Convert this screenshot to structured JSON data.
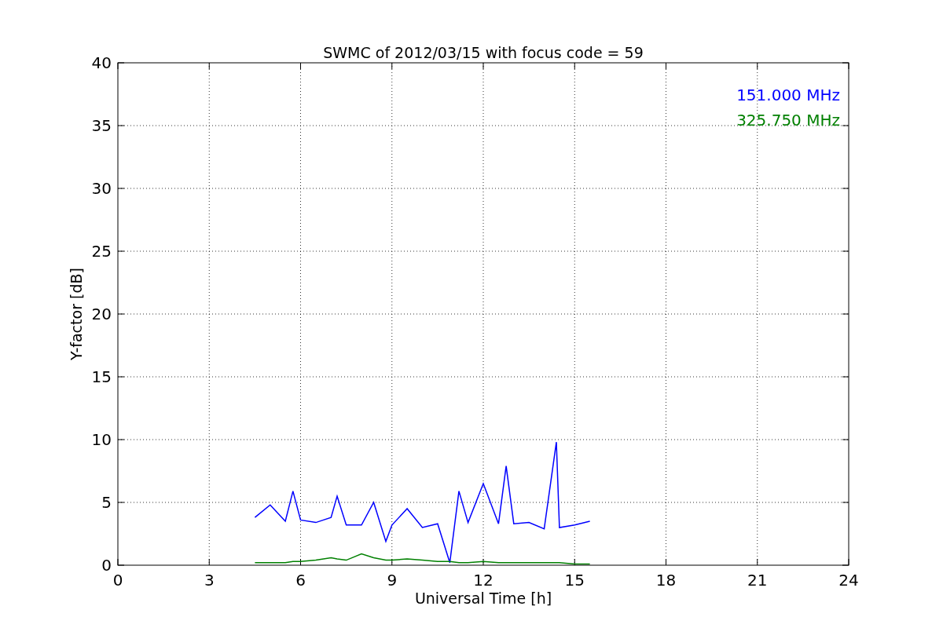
{
  "chart_data": {
    "type": "line",
    "title": "SWMC of 2012/03/15 with focus code = 59",
    "xlabel": "Universal Time [h]",
    "ylabel": "Y-factor [dB]",
    "x": [
      4.5,
      5,
      5.5,
      5.75,
      6,
      6.5,
      7,
      7.2,
      7.5,
      8,
      8.4,
      8.8,
      9,
      9.5,
      10,
      10.5,
      10.9,
      11.2,
      11.5,
      12,
      12.5,
      12.75,
      13,
      13.5,
      14,
      14.4,
      14.5,
      15,
      15.5
    ],
    "series": [
      {
        "name": "151.000 MHz",
        "color": "#0000ff",
        "values": [
          3.8,
          4.8,
          3.5,
          5.9,
          3.6,
          3.4,
          3.8,
          5.5,
          3.2,
          3.2,
          5.0,
          1.9,
          3.2,
          4.5,
          3.0,
          3.3,
          0.2,
          5.9,
          3.4,
          6.5,
          3.3,
          7.9,
          3.3,
          3.4,
          2.9,
          9.8,
          3.0,
          3.2,
          3.5
        ]
      },
      {
        "name": "325.750 MHz",
        "color": "#008000",
        "values": [
          0.2,
          0.2,
          0.2,
          0.3,
          0.3,
          0.4,
          0.6,
          0.5,
          0.4,
          0.9,
          0.6,
          0.4,
          0.4,
          0.5,
          0.4,
          0.3,
          0.3,
          0.2,
          0.2,
          0.3,
          0.2,
          0.2,
          0.2,
          0.2,
          0.2,
          0.2,
          0.2,
          0.1,
          0.1
        ]
      }
    ],
    "grid": true,
    "xlim": [
      0,
      24
    ],
    "ylim": [
      0,
      40
    ],
    "xticks": [
      0,
      3,
      6,
      9,
      12,
      15,
      18,
      21,
      24
    ],
    "yticks": [
      0,
      5,
      10,
      15,
      20,
      25,
      30,
      35,
      40
    ]
  }
}
